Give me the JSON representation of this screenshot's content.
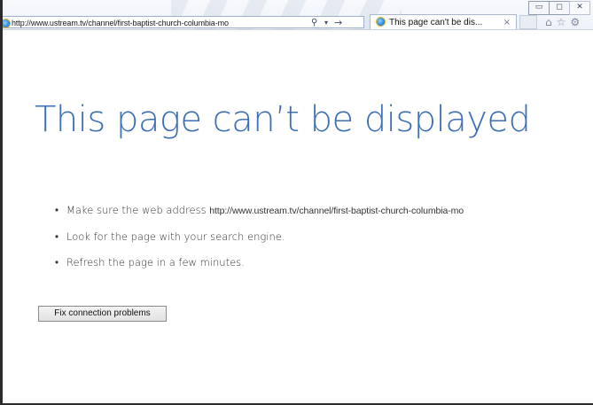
{
  "window": {
    "minimize_glyph": "▭",
    "maximize_glyph": "◻",
    "close_glyph": "✕"
  },
  "address_bar": {
    "url": "http://www.ustream.tv/channel/first-baptist-church-columbia-mo",
    "search_glyph": "⚲",
    "dropdown_glyph": "▾",
    "go_glyph": "→"
  },
  "tab": {
    "title": "This page can't be dis...",
    "close_glyph": "×"
  },
  "toolbar": {
    "home_glyph": "⌂",
    "favorites_glyph": "☆",
    "tools_glyph": "⚙"
  },
  "error_page": {
    "heading": "This page can’t be displayed",
    "bullet_glyph": "•",
    "bullet_1_prefix": "Make sure the web address ",
    "bullet_1_url": "http://www.ustream.tv/channel/first-baptist-church-columbia-mo",
    "bullet_2": "Look for the page with your search engine.",
    "bullet_3": "Refresh the page in a few minutes.",
    "fix_button_label": "Fix connection problems"
  },
  "colors": {
    "heading_blue": "#3b6fb6",
    "chrome_border": "#9eb1c9"
  }
}
